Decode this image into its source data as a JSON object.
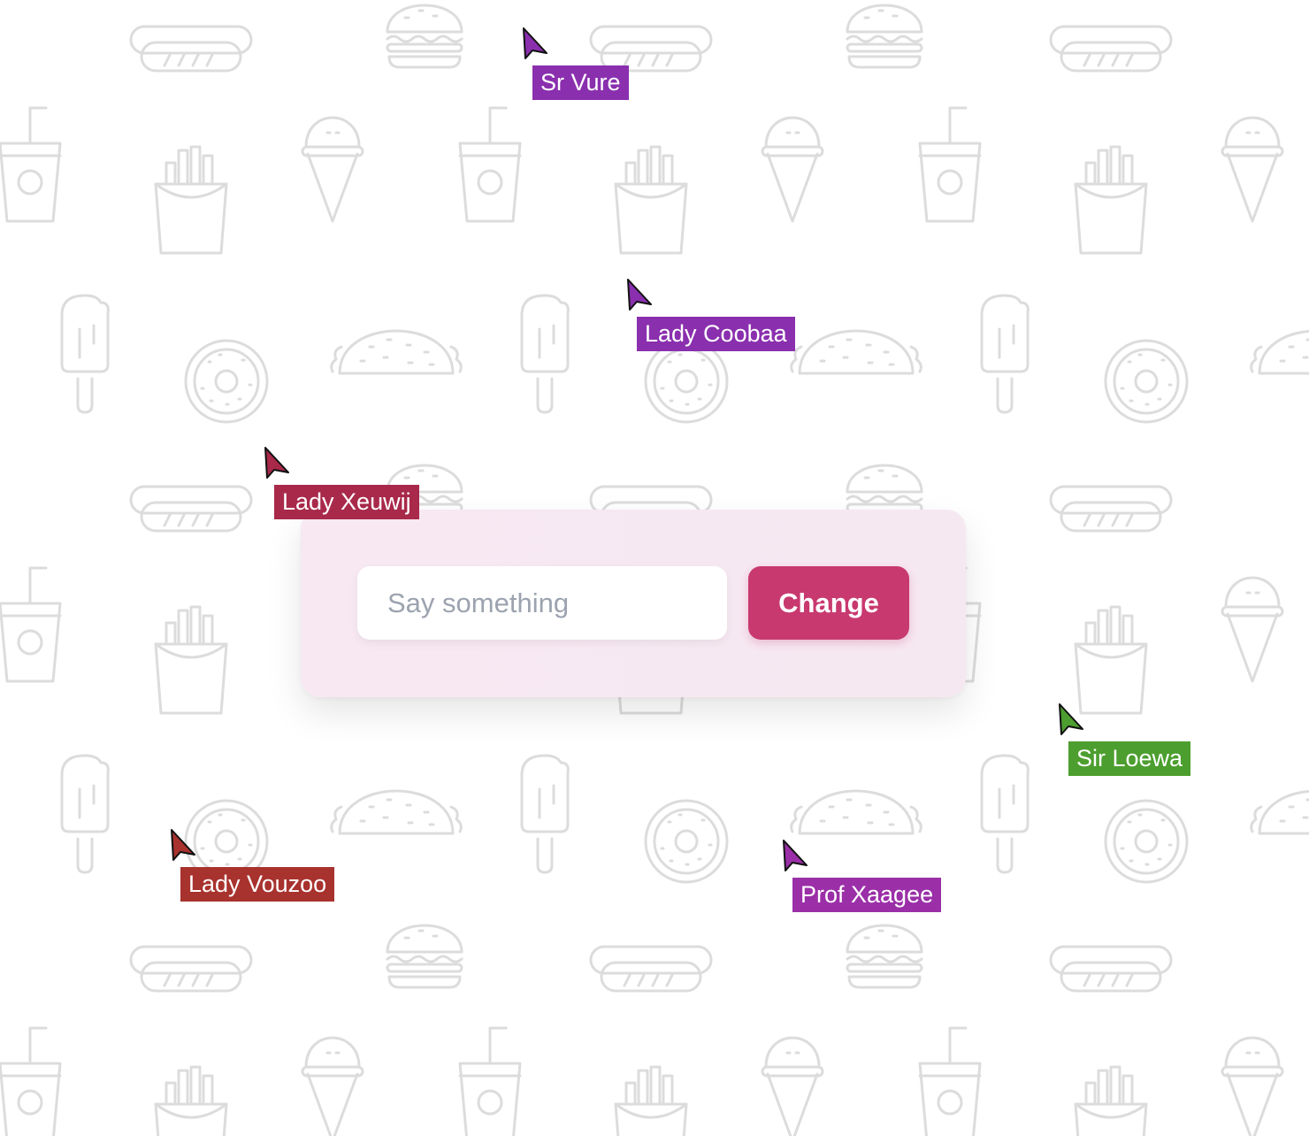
{
  "composer": {
    "input_placeholder": "Say something",
    "input_value": "",
    "button_label": "Change"
  },
  "background": {
    "pattern_icons": [
      "hotdog-icon",
      "burger-icon",
      "soda-cup-icon",
      "fries-icon",
      "ice-cream-cone-icon",
      "popsicle-icon",
      "donut-icon",
      "taco-icon"
    ],
    "icon_color": "#dcdcdc"
  },
  "cursors": [
    {
      "name": "Sr Vure",
      "color": "#8a2fae"
    },
    {
      "name": "Lady Coobaa",
      "color": "#8a2fae"
    },
    {
      "name": "Lady Xeuwij",
      "color": "#a8294a"
    },
    {
      "name": "Sir Loewa",
      "color": "#4c9e2e"
    },
    {
      "name": "Lady Vouzoo",
      "color": "#a8322e"
    },
    {
      "name": "Prof Xaagee",
      "color": "#9b2fa8"
    }
  ]
}
